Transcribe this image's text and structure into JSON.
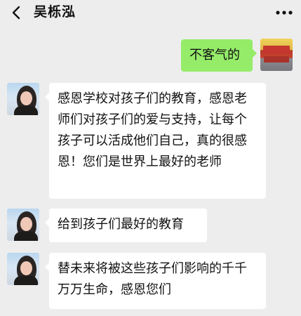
{
  "header": {
    "title": "吴栎泓",
    "back_icon": "chevron-left-icon",
    "more_icon": "more-dots-icon"
  },
  "messages": [
    {
      "sender": "self",
      "text": "不客气的",
      "bubble_color": "#95ec69"
    },
    {
      "sender": "other",
      "text": "感恩学校对孩子们的教育，感恩老师们对孩子们的爱与支持，让每个孩子可以活成他们自己，真的很感恩！您们是世界上最好的老师",
      "bubble_color": "#ffffff"
    },
    {
      "sender": "other",
      "text": "给到孩子们最好的教育",
      "bubble_color": "#ffffff"
    },
    {
      "sender": "other",
      "text": "替未来将被这些孩子们影响的千千万万生命，感恩您们",
      "bubble_color": "#ffffff"
    }
  ],
  "colors": {
    "background": "#ededed",
    "self_bubble": "#95ec69",
    "other_bubble": "#ffffff"
  }
}
